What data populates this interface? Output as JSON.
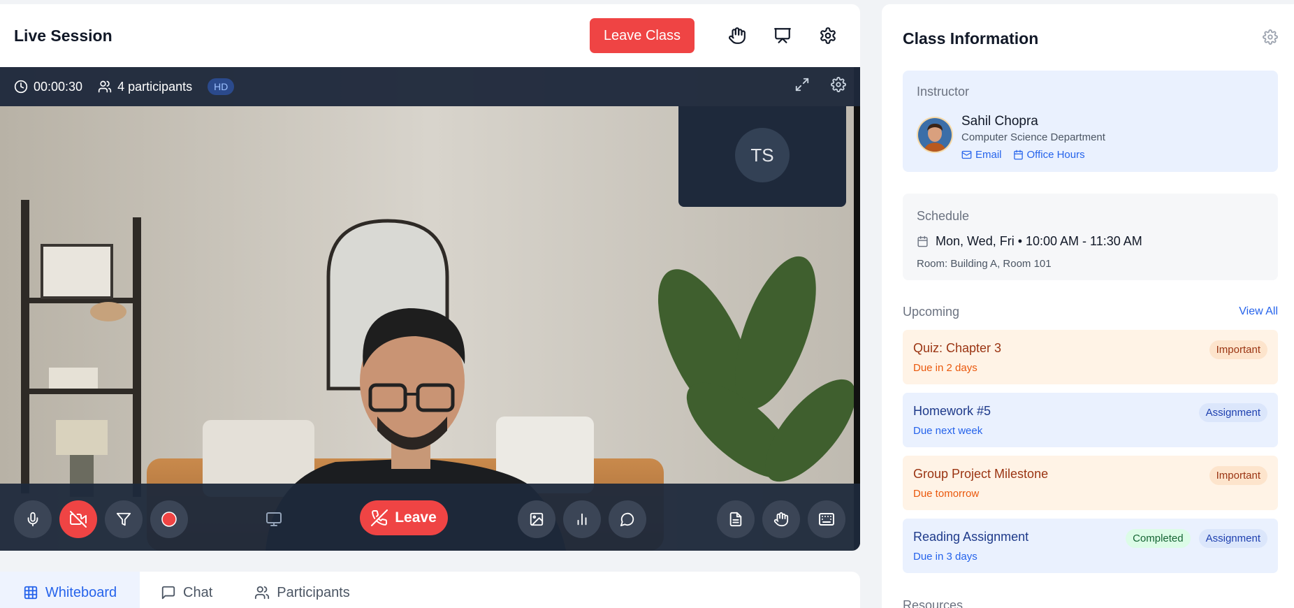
{
  "header": {
    "title": "Live Session",
    "leave_class_label": "Leave Class"
  },
  "video": {
    "timer": "00:00:30",
    "participants": "4 participants",
    "quality_badge": "HD",
    "self_tile_initials": "TS"
  },
  "controls": {
    "leave_label": "Leave"
  },
  "tabs": [
    {
      "label": "Whiteboard",
      "icon": "grid-icon",
      "active": true
    },
    {
      "label": "Chat",
      "icon": "chat-icon",
      "active": false
    },
    {
      "label": "Participants",
      "icon": "users-icon",
      "active": false
    }
  ],
  "class_info": {
    "title": "Class Information",
    "instructor": {
      "label": "Instructor",
      "name": "Sahil Chopra",
      "department": "Computer Science Department",
      "email_label": "Email",
      "office_hours_label": "Office Hours"
    },
    "schedule": {
      "label": "Schedule",
      "time": "Mon, Wed, Fri • 10:00 AM - 11:30 AM",
      "room": "Room: Building A, Room 101"
    },
    "upcoming": {
      "label": "Upcoming",
      "view_all": "View All",
      "items": [
        {
          "title": "Quiz: Chapter 3",
          "due": "Due in 2 days",
          "badges": [
            "Important"
          ]
        },
        {
          "title": "Homework #5",
          "due": "Due next week",
          "badges": [
            "Assignment"
          ]
        },
        {
          "title": "Group Project Milestone",
          "due": "Due tomorrow",
          "badges": [
            "Important"
          ]
        },
        {
          "title": "Reading Assignment",
          "due": "Due in 3 days",
          "badges": [
            "Completed",
            "Assignment"
          ]
        }
      ]
    },
    "resources_label": "Resources"
  },
  "colors": {
    "accent": "#2563eb",
    "danger": "#ef4444",
    "dark_bar": "#1e293b"
  }
}
